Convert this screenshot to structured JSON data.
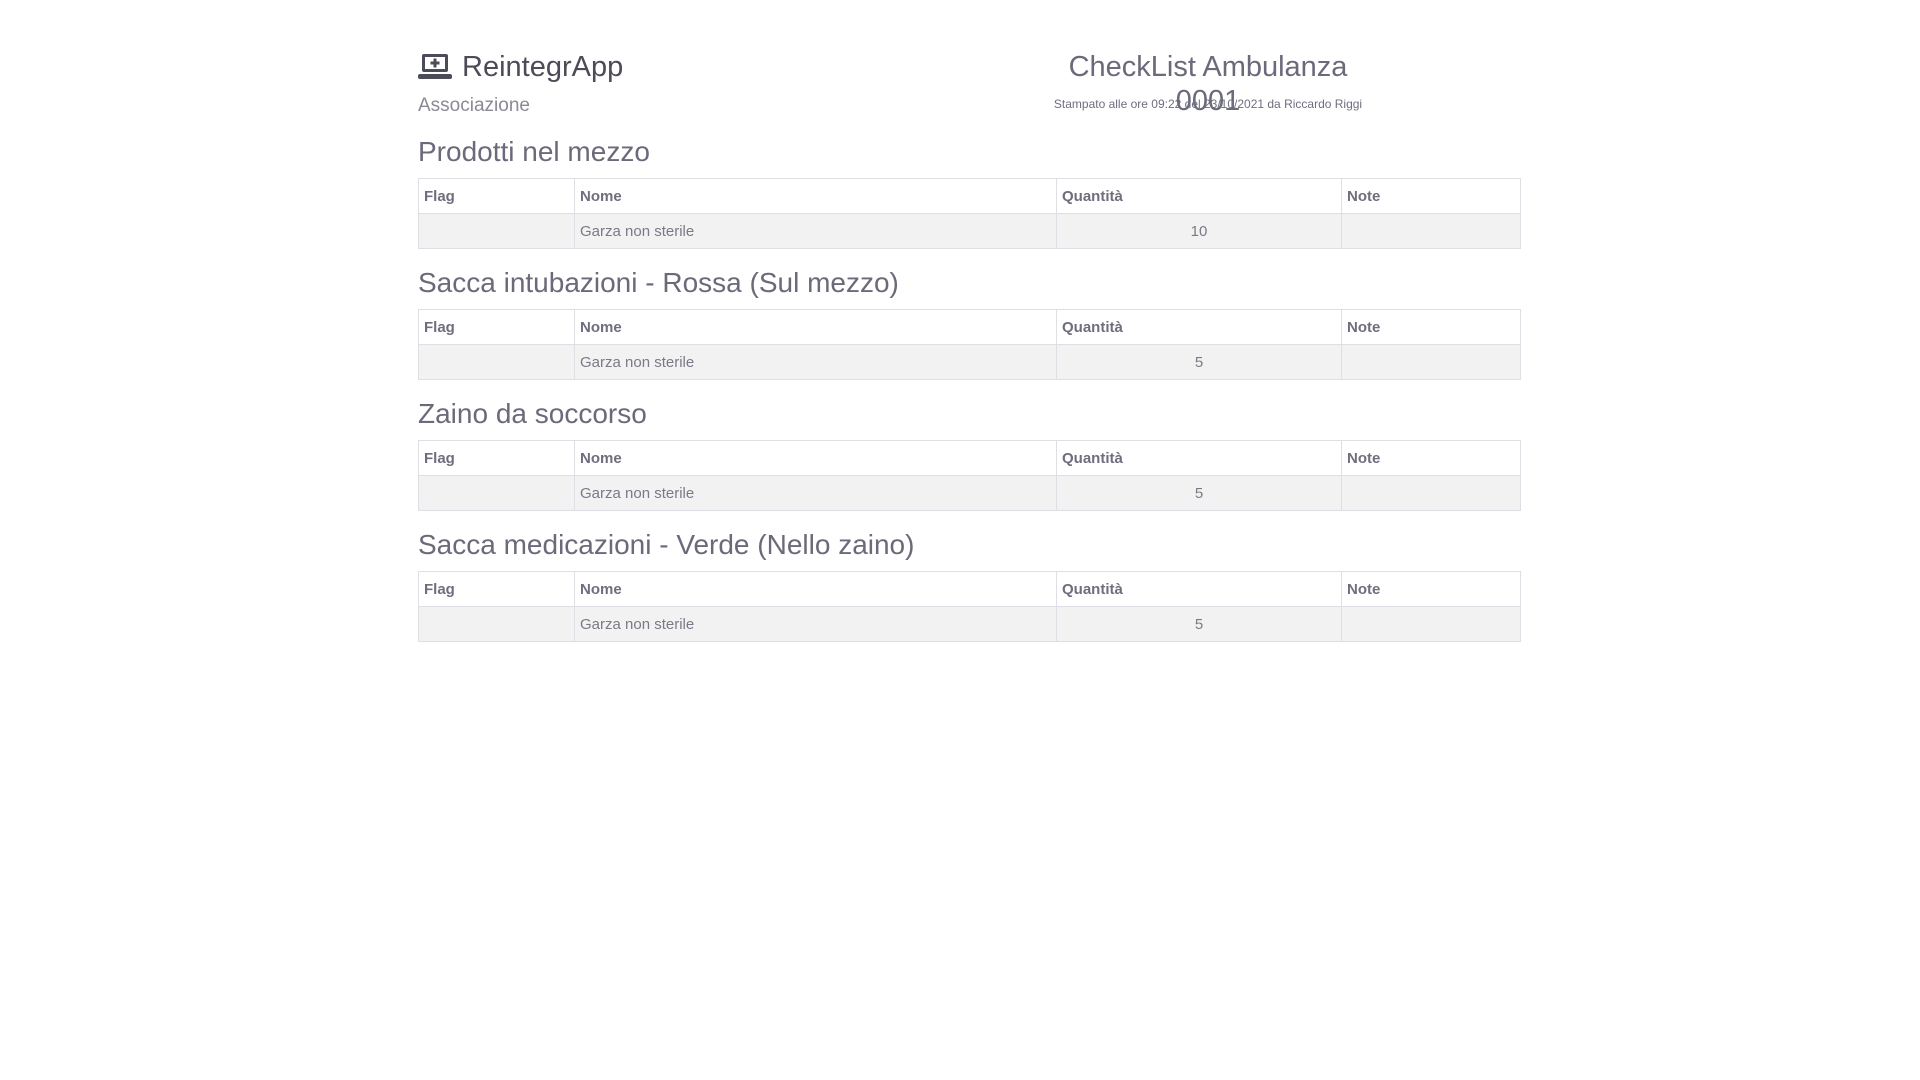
{
  "brand": {
    "name": "ReintegrApp",
    "subtitle": "Associazione",
    "icon": "laptop-medical-icon"
  },
  "document": {
    "title": "CheckList Ambulanza 0001",
    "printed_info": "Stampato alle ore 09:22 del 23/10/2021 da Riccardo Riggi"
  },
  "columns": {
    "flag": "Flag",
    "nome": "Nome",
    "quantita": "Quantità",
    "note": "Note"
  },
  "sections": [
    {
      "title": "Prodotti nel mezzo",
      "rows": [
        {
          "flag": "",
          "nome": "Garza non sterile",
          "quantita": "10",
          "note": ""
        }
      ]
    },
    {
      "title": "Sacca intubazioni - Rossa (Sul mezzo)",
      "rows": [
        {
          "flag": "",
          "nome": "Garza non sterile",
          "quantita": "5",
          "note": ""
        }
      ]
    },
    {
      "title": "Zaino da soccorso",
      "rows": [
        {
          "flag": "",
          "nome": "Garza non sterile",
          "quantita": "5",
          "note": ""
        }
      ]
    },
    {
      "title": "Sacca medicazioni - Verde (Nello zaino)",
      "rows": [
        {
          "flag": "",
          "nome": "Garza non sterile",
          "quantita": "5",
          "note": ""
        }
      ]
    }
  ]
}
